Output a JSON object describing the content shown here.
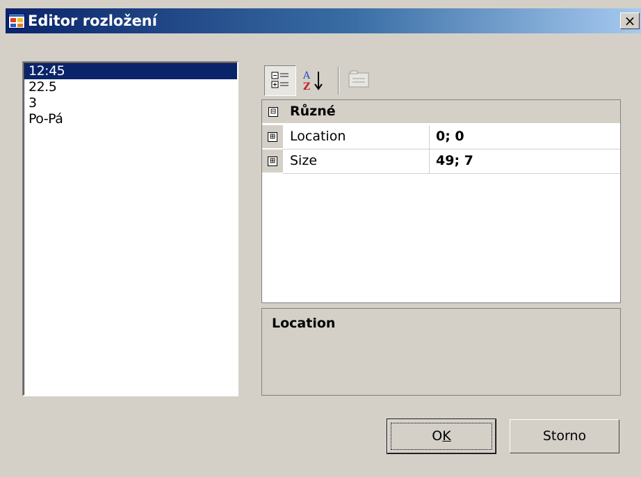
{
  "window": {
    "title": "Editor rozložení",
    "close_glyph": "×",
    "title_icon": "layout-editor-icon",
    "colors": {
      "titlebar_start": "#0a246a",
      "titlebar_end": "#a6caf0",
      "face": "#d4d0c8",
      "selection": "#0a246a"
    }
  },
  "list": {
    "items": [
      "12:45",
      "22.5",
      "3",
      "Po-Pá"
    ],
    "selected_index": 0
  },
  "toolbar": {
    "categorized_icon": "categorized-view-icon",
    "alphabetical_icon": "alphabetical-sort-icon",
    "property_pages_icon": "property-pages-icon"
  },
  "property_grid": {
    "category": {
      "expander": "⊟",
      "label": "Různé"
    },
    "rows": [
      {
        "expander": "⊞",
        "name": "Location",
        "value": "0; 0"
      },
      {
        "expander": "⊞",
        "name": "Size",
        "value": "49; 7"
      }
    ]
  },
  "description": {
    "title": "Location"
  },
  "buttons": {
    "ok_prefix": "O",
    "ok_mnemonic": "K",
    "cancel": "Storno"
  }
}
